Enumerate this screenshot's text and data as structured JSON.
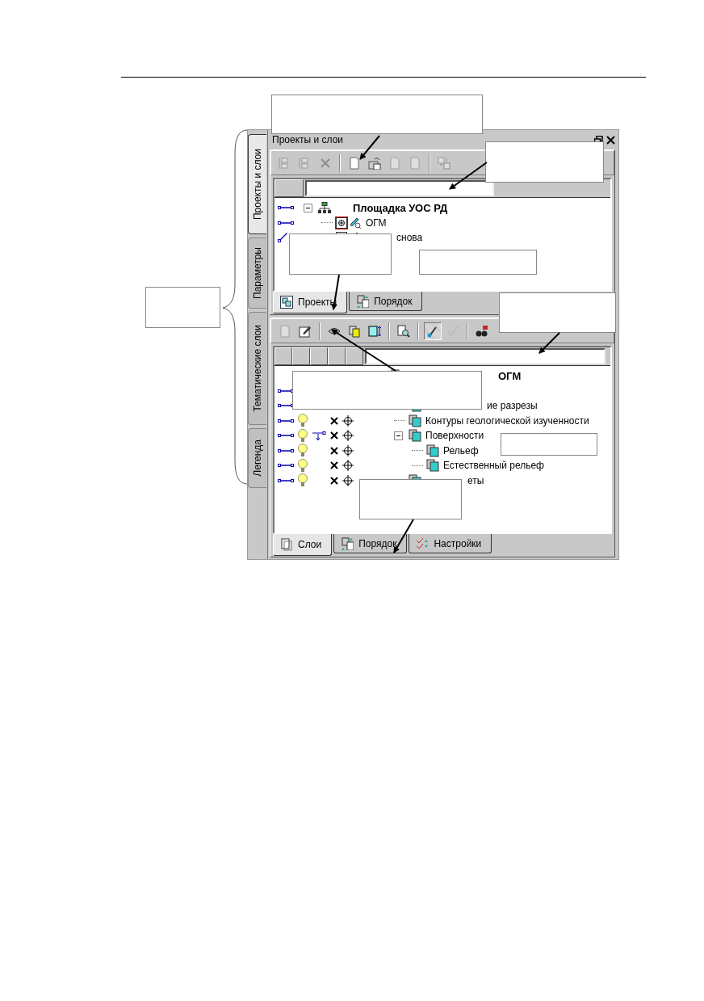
{
  "side_tabs": [
    {
      "label": "Проекты и слои",
      "selected": true
    },
    {
      "label": "Параметры",
      "selected": false
    },
    {
      "label": "Тематические слои",
      "selected": false
    },
    {
      "label": "Легенда",
      "selected": false
    }
  ],
  "panel": {
    "title": "Проекты и слои"
  },
  "projects": {
    "toolbar": [
      {
        "kind": "button",
        "disabled": true,
        "pressed": false
      },
      {
        "kind": "button",
        "disabled": true,
        "pressed": false
      },
      {
        "kind": "button",
        "disabled": true,
        "pressed": false
      },
      {
        "kind": "separator"
      },
      {
        "kind": "button",
        "disabled": false,
        "pressed": false
      },
      {
        "kind": "button",
        "disabled": false,
        "pressed": false
      },
      {
        "kind": "button",
        "disabled": true,
        "pressed": false
      },
      {
        "kind": "button",
        "disabled": true,
        "pressed": false
      },
      {
        "kind": "separator"
      },
      {
        "kind": "button",
        "disabled": true,
        "pressed": false
      }
    ],
    "tree": [
      {
        "label": "Площадка УОС РД",
        "linked": true,
        "active": false,
        "expanded": true,
        "children": [
          {
            "label": "ОГМ",
            "linked": true,
            "active": true
          },
          {
            "label": "снова",
            "linked": false
          }
        ]
      }
    ],
    "tabs": [
      {
        "label": "Проекты",
        "selected": true
      },
      {
        "label": "Порядок",
        "selected": false
      }
    ]
  },
  "layers": {
    "toolbar": [
      {
        "kind": "button",
        "disabled": true,
        "pressed": false
      },
      {
        "kind": "button",
        "disabled": false,
        "pressed": false
      },
      {
        "kind": "separator"
      },
      {
        "kind": "button",
        "disabled": false,
        "pressed": false
      },
      {
        "kind": "button",
        "disabled": false,
        "pressed": false
      },
      {
        "kind": "button",
        "disabled": false,
        "pressed": false
      },
      {
        "kind": "separator"
      },
      {
        "kind": "button",
        "disabled": false,
        "pressed": false
      },
      {
        "kind": "separator"
      },
      {
        "kind": "button",
        "disabled": false,
        "pressed": true
      },
      {
        "kind": "button",
        "disabled": true,
        "pressed": false
      },
      {
        "kind": "separator"
      },
      {
        "kind": "button",
        "disabled": false,
        "pressed": false
      }
    ],
    "tree": [
      {
        "label": "ОГМ",
        "children": [
          {
            "linked": true
          },
          {
            "label": "ие разрезы",
            "linked": true
          },
          {
            "label": "Контуры геологической изученности",
            "linked": true,
            "layer_controls": true,
            "filter": false
          },
          {
            "label": "Поверхности",
            "linked": true,
            "expanded": true,
            "layer_controls": true,
            "filter": true,
            "children": [
              {
                "label": "Рельеф",
                "linked": true,
                "layer_controls": true,
                "filter": false
              },
              {
                "label": "Естественный рельеф",
                "linked": true,
                "layer_controls": true,
                "filter": false
              }
            ]
          },
          {
            "label": "еты",
            "linked": true,
            "layer_controls": true,
            "filter": false
          }
        ]
      }
    ],
    "tabs": [
      {
        "label": "Слои",
        "selected": true
      },
      {
        "label": "Порядок",
        "selected": false
      },
      {
        "label": "Настройки",
        "selected": false
      }
    ]
  }
}
